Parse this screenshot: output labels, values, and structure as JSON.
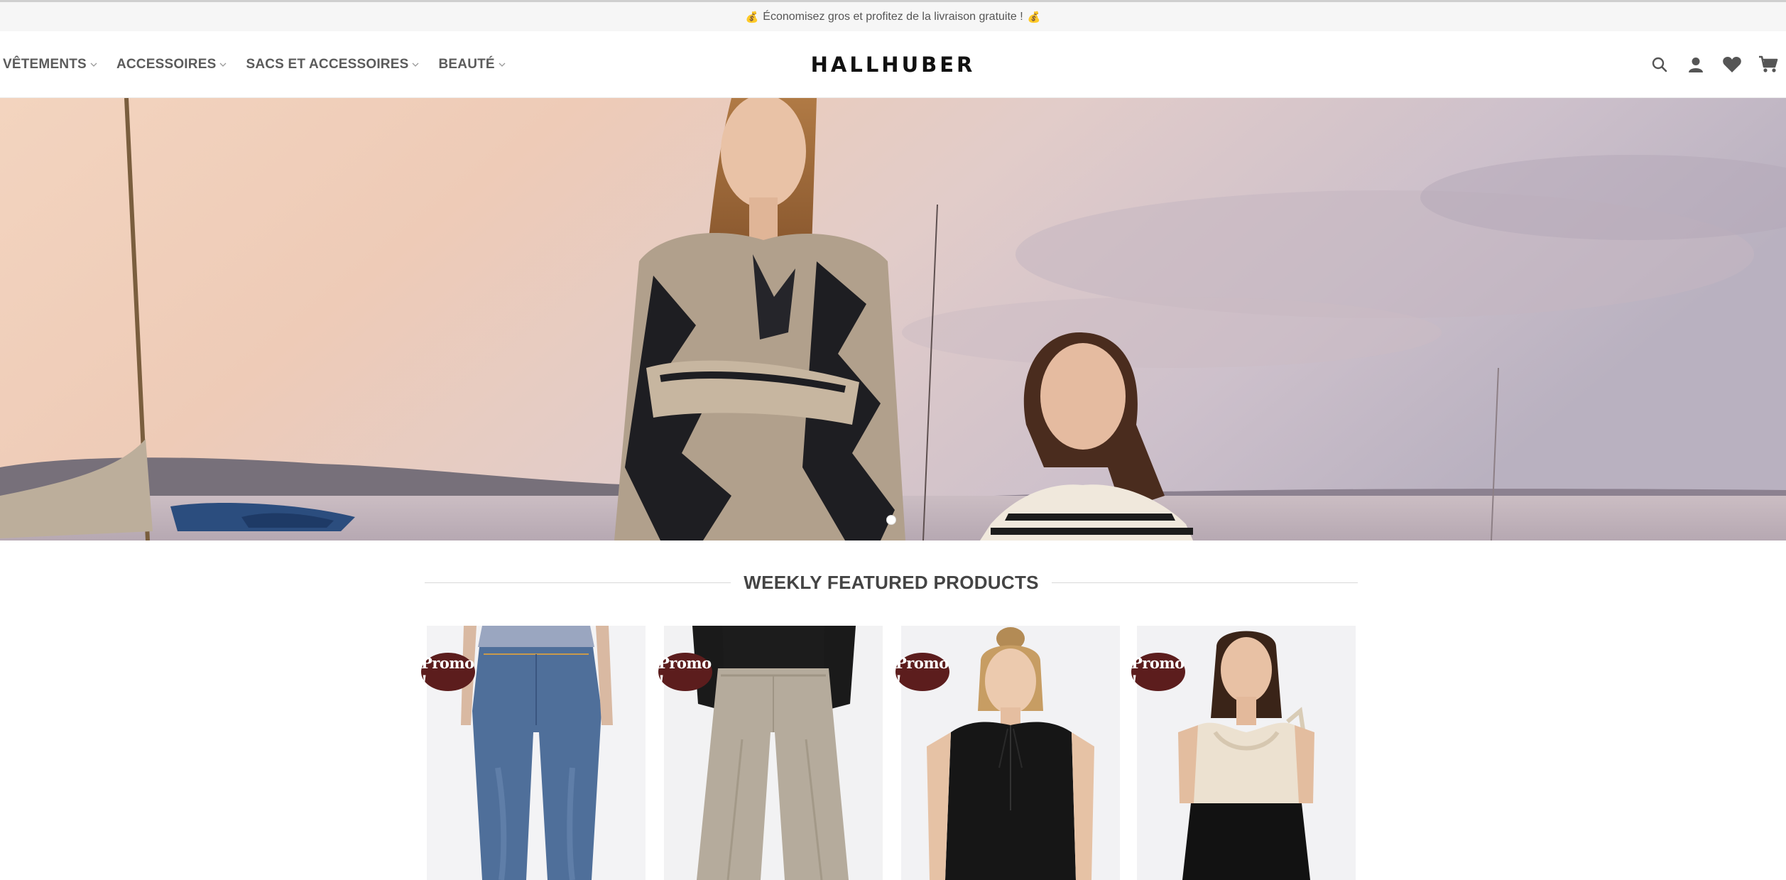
{
  "topbar": {
    "announcement": "Économisez gros et profitez de la livraison gratuite !",
    "icon_left": "money-bag-icon",
    "icon_right": "money-bag-icon"
  },
  "header": {
    "logo": "HALLHUBER",
    "nav": [
      {
        "label": "VÊTEMENTS"
      },
      {
        "label": "ACCESSOIRES"
      },
      {
        "label": "SACS ET ACCESSOIRES"
      },
      {
        "label": "BEAUTÉ"
      }
    ],
    "icons": [
      "search-icon",
      "account-icon",
      "wishlist-heart-icon",
      "cart-icon"
    ]
  },
  "hero": {
    "slides_count": 1,
    "active_slide": 1
  },
  "featured": {
    "title": "WEEKLY FEATURED PRODUCTS",
    "products": [
      {
        "badge": "Promo !",
        "image": "blue-skinny-jeans"
      },
      {
        "badge": "Promo !",
        "image": "beige-wide-leg-pants"
      },
      {
        "badge": "Promo !",
        "image": "black-sleeveless-blouse"
      },
      {
        "badge": "Promo !",
        "image": "cream-cowl-neck-top"
      }
    ]
  },
  "colors": {
    "promo_badge": "#5c1d1d",
    "topbar_bg": "#f6f6f6",
    "nav_text": "#5b5b5b"
  }
}
